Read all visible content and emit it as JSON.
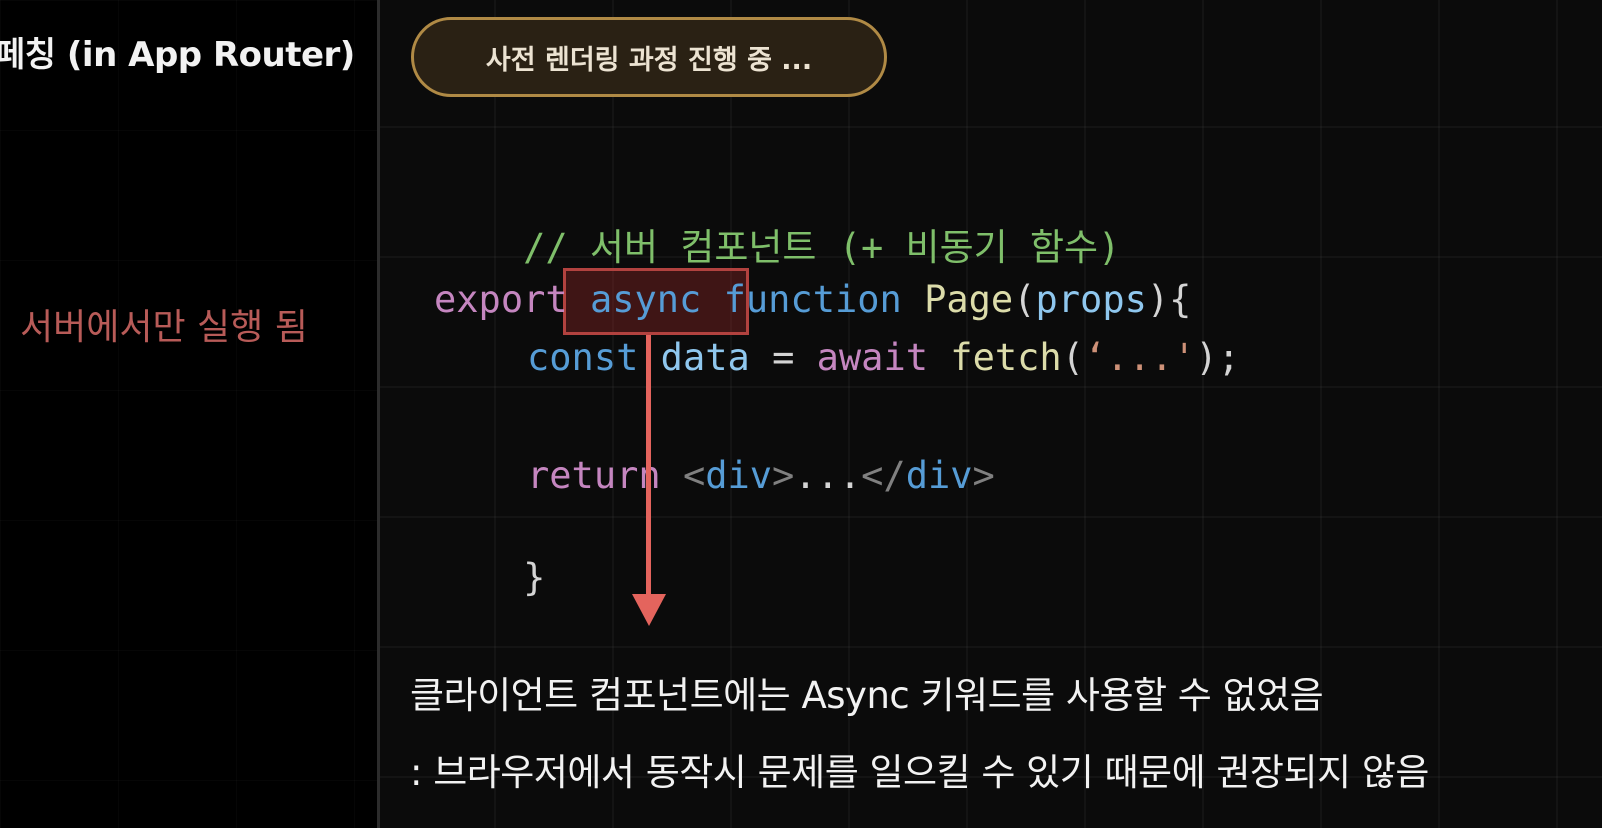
{
  "left": {
    "title": "페칭 (in App Router)",
    "note": "서버에서만 실행 됨"
  },
  "status_pill": {
    "label": "사전 렌더링 과정 진행 중 ..."
  },
  "code": {
    "comment": "// 서버 컴포넌트 (+ 비동기 함수)",
    "line1": {
      "export": "export",
      "async": "async",
      "function": "function",
      "name": "Page",
      "open_paren": "(",
      "param": "props",
      "close": "){"
    },
    "line2": {
      "const": "const",
      "var": "data",
      "eq": "=",
      "await": "await",
      "fetch": "fetch",
      "open": "(",
      "str": "‘...'",
      "close": ");"
    },
    "line3": {
      "return": "return",
      "lt1": "<",
      "tag1": "div",
      "gt1": ">",
      "dots": "...",
      "lt2": "</",
      "tag2": "div",
      "gt2": ">"
    },
    "line4": "}"
  },
  "explanation": {
    "line1": "클라이언트 컴포넌트에는 Async 키워드를 사용할 수 없었음",
    "line2": ": 브라우저에서 동작시 문제를 일으킬 수 있기 때문에 권장되지 않음"
  },
  "colors": {
    "comment": "#7fbf6a",
    "keyword_pink": "#c586c0",
    "keyword_blue": "#569cd6",
    "function_name": "#dcdcaa",
    "string": "#ce9178",
    "highlight": "#b2423f",
    "arrow": "#e4645d",
    "pill_border": "#b08a45",
    "note": "#b85b58"
  }
}
